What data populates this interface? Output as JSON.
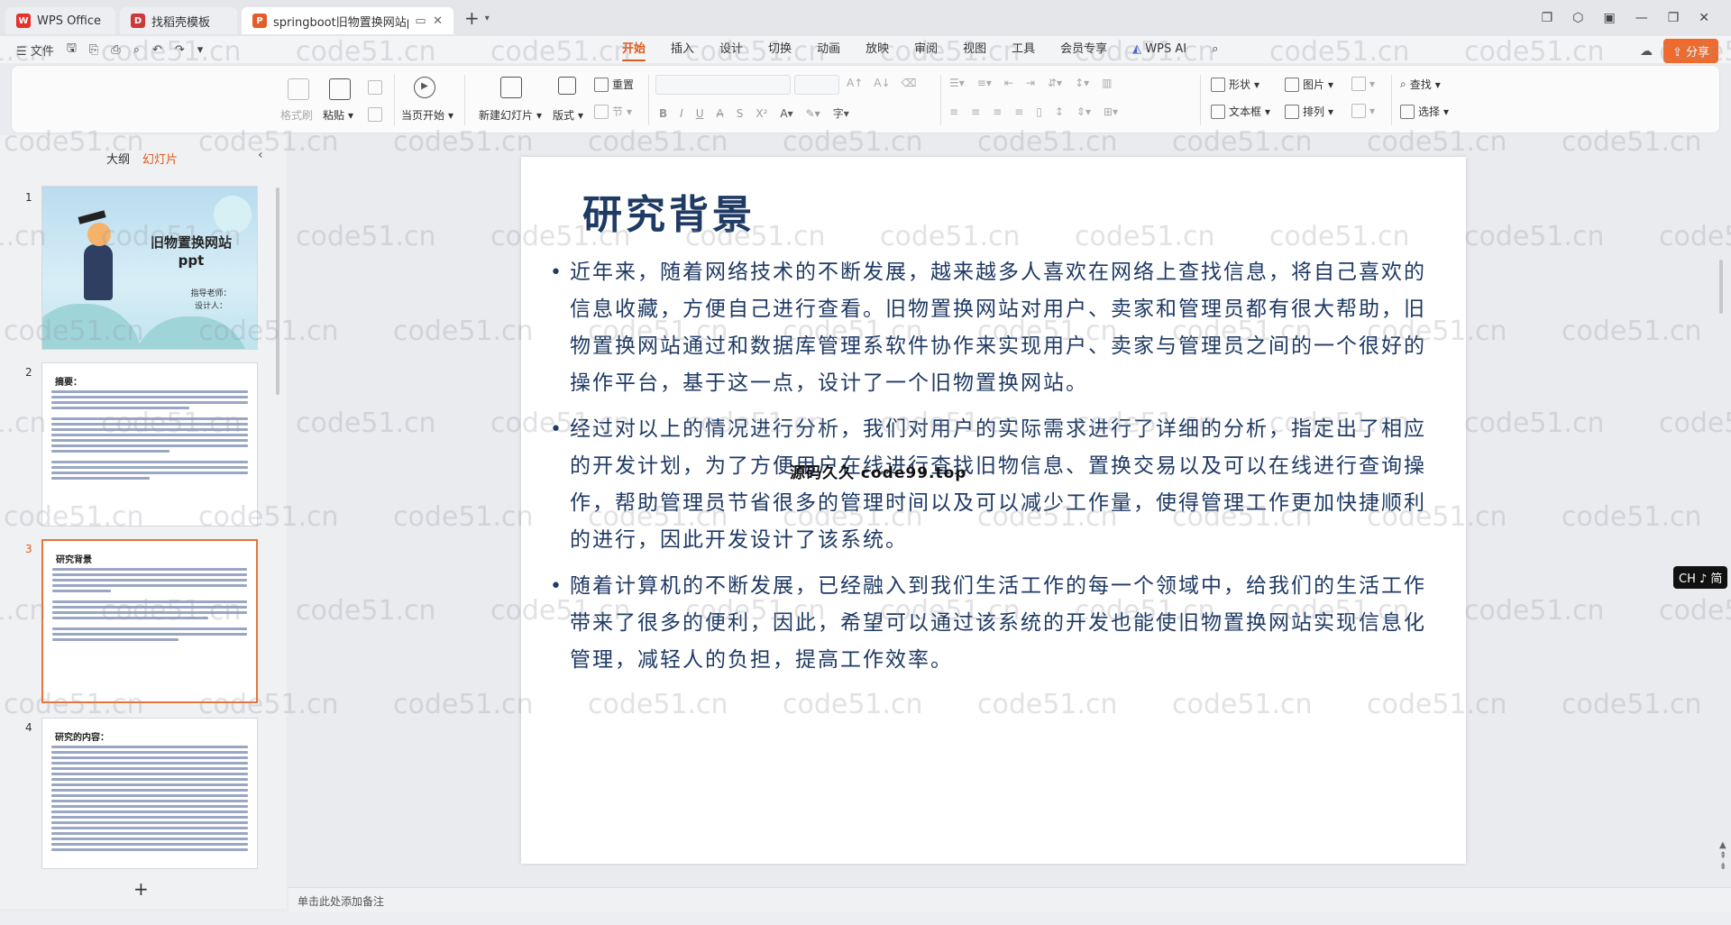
{
  "tabs": [
    {
      "label": "WPS Office"
    },
    {
      "label": "找稻壳模板"
    },
    {
      "label": "springboot旧物置换网站ppt"
    }
  ],
  "menu": {
    "file": "文件",
    "tabs": [
      "开始",
      "插入",
      "设计",
      "切换",
      "动画",
      "放映",
      "审阅",
      "视图",
      "工具",
      "会员专享"
    ],
    "wps_ai": "WPS AI",
    "share": "分享"
  },
  "ribbon": {
    "format_painter": "格式刷",
    "paste": "粘贴",
    "play_from_current": "当页开始",
    "new_slide": "新建幻灯片",
    "layout": "版式",
    "reset": "重置",
    "section": "节",
    "shape": "形状",
    "picture": "图片",
    "find": "查找",
    "textbox": "文本框",
    "arrange": "排列",
    "select": "选择"
  },
  "panel": {
    "tab_outline": "大纲",
    "tab_slides": "幻灯片",
    "slide_numbers": [
      "1",
      "2",
      "3",
      "4"
    ],
    "thumb1_title": "旧物置换网站ppt",
    "thumb1_sub": "指导老师：\n设计人：",
    "thumb2_title": "摘要：",
    "thumb3_title": "研究背景",
    "thumb4_title": "研究的内容："
  },
  "slide": {
    "title": "研究背景",
    "bullets": [
      "近年来，随着网络技术的不断发展，越来越多人喜欢在网络上查找信息，将自己喜欢的信息收藏，方便自己进行查看。旧物置换网站对用户、卖家和管理员都有很大帮助，旧物置换网站通过和数据库管理系软件协作来实现用户、卖家与管理员之间的一个很好的操作平台，基于这一点，设计了一个旧物置换网站。",
      "经过对以上的情况进行分析，我们对用户的实际需求进行了详细的分析，指定出了相应的开发计划，为了方便用户在线进行查找旧物信息、置换交易以及可以在线进行查询操作，帮助管理员节省很多的管理时间以及可以减少工作量，使得管理工作更加快捷顺利的进行，因此开发设计了该系统。",
      "随着计算机的不断发展，已经融入到我们生活工作的每一个领域中，给我们的生活工作带来了很多的便利，因此，希望可以通过该系统的开发也能使旧物置换网站实现信息化管理，减轻人的负担，提高工作效率。"
    ],
    "overlay": "源码久久 code99.top"
  },
  "notes_placeholder": "单击此处添加备注",
  "ime": "CH ♪ 简",
  "watermark": "code51.cn",
  "colors": {
    "accent": "#e05a1b",
    "title": "#1f3a64",
    "share": "#ef6a2b"
  }
}
